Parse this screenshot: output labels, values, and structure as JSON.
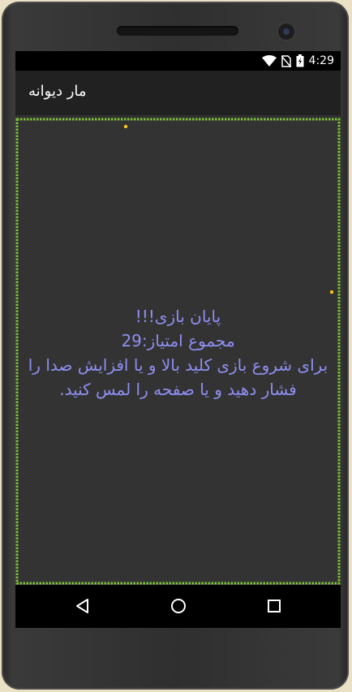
{
  "status_bar": {
    "time": "4:29",
    "icons": [
      "wifi-icon",
      "no-sim-icon",
      "battery-charging-icon"
    ]
  },
  "app": {
    "title": "مار دیوانه"
  },
  "game": {
    "message_line1": "پایان بازی!!!",
    "message_line2": "مجموع امتیاز:29",
    "message_line3": "برای شروع بازی کلید بالا و یا افزایش صدا را",
    "message_line4": "فشار دهید و یا صفحه را لمس کنید.",
    "border_color": "#7cc13a",
    "food_color": "#f4c020",
    "text_color": "#8f8ff2"
  },
  "navigation": {
    "buttons": [
      "back-icon",
      "home-icon",
      "recents-icon"
    ]
  }
}
